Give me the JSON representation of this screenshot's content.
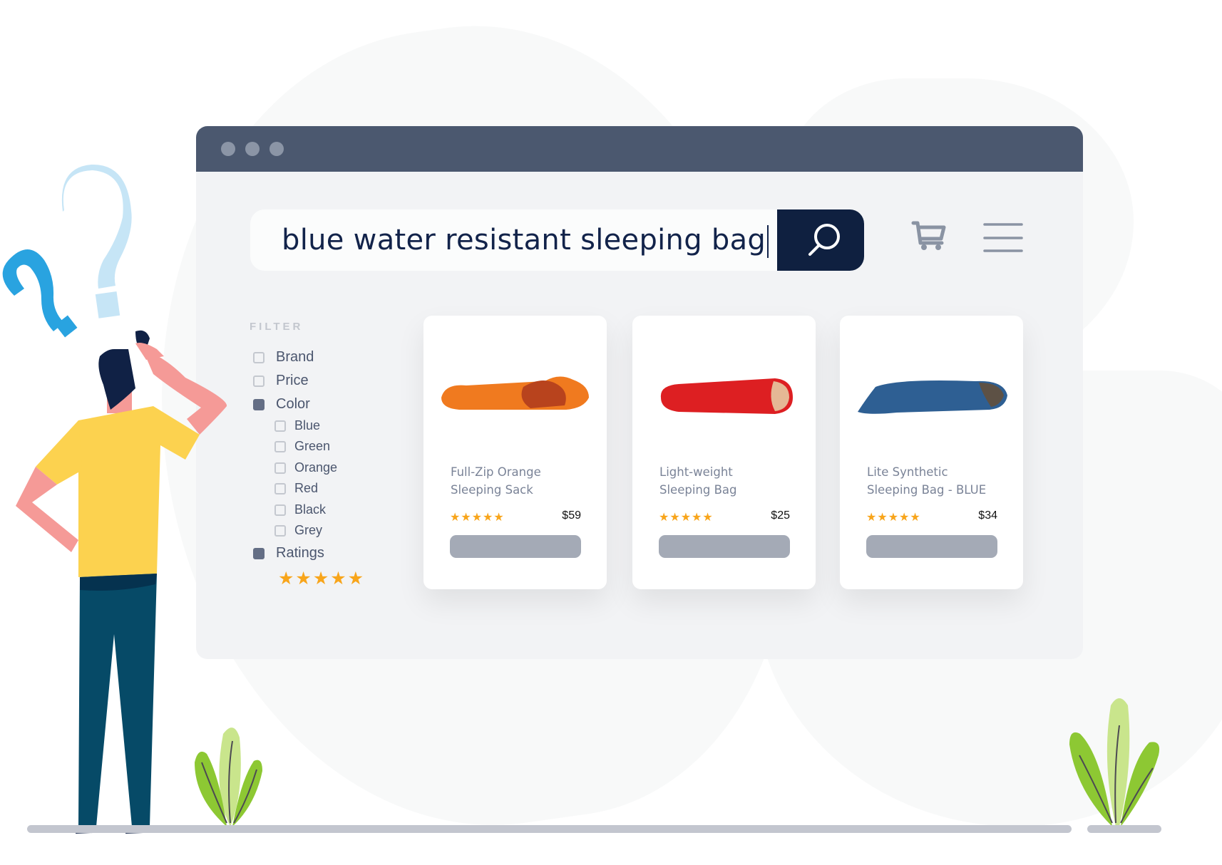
{
  "search": {
    "query": "blue water resistant sleeping bag",
    "button_icon": "search-icon"
  },
  "header_icons": [
    "cart-icon",
    "hamburger-menu-icon"
  ],
  "filter": {
    "title": "FILTER",
    "items": [
      {
        "label": "Brand",
        "checked": false
      },
      {
        "label": "Price",
        "checked": false
      },
      {
        "label": "Color",
        "checked": true,
        "options": [
          {
            "label": "Blue",
            "checked": false
          },
          {
            "label": "Green",
            "checked": false
          },
          {
            "label": "Orange",
            "checked": false
          },
          {
            "label": "Red",
            "checked": false
          },
          {
            "label": "Black",
            "checked": false
          },
          {
            "label": "Grey",
            "checked": false
          }
        ]
      },
      {
        "label": "Ratings",
        "checked": true
      }
    ],
    "ratings_stars": "★★★★★",
    "ratings_value": 5
  },
  "products": [
    {
      "name_line1": "Full-Zip Orange",
      "name_line2": "Sleeping Sack",
      "price": "$59",
      "stars": "★★★★★",
      "rating": 5,
      "color": "#f07a1f",
      "inner_color": "#b8431d"
    },
    {
      "name_line1": "Light-weight",
      "name_line2": "Sleeping Bag",
      "price": "$25",
      "stars": "★★★★★",
      "rating": 5,
      "color": "#dd1f22",
      "inner_color": "#e5b895"
    },
    {
      "name_line1": "Lite Synthetic",
      "name_line2": "Sleeping Bag - BLUE",
      "price": "$34",
      "stars": "★★★★★",
      "rating": 5,
      "color": "#2e5f93",
      "inner_color": "#5d5145"
    }
  ],
  "colors": {
    "titlebar": "#4b586f",
    "search_button": "#0f2040",
    "star": "#f8a51b",
    "card_button": "#a4aab6"
  }
}
